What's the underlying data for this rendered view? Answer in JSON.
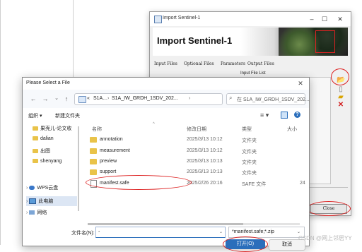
{
  "import_window": {
    "title": "Import Sentinel-1",
    "heading": "Import Sentinel-1",
    "min_icon": "minimize-icon",
    "max_icon": "maximize-icon",
    "close_icon": "close-icon",
    "tabs": [
      {
        "label": "Input Files"
      },
      {
        "label": "Optional Files"
      },
      {
        "label": "Parameters"
      },
      {
        "label": "Output Files"
      }
    ],
    "list_label": "Input File List",
    "close_label": "Close",
    "side_icons": [
      "add-file-icon",
      "page-icon",
      "folder-icon",
      "remove-icon"
    ]
  },
  "file_dialog": {
    "title": "Please Select a File",
    "nav": {
      "back": "←",
      "forward": "→",
      "recent": "⌄",
      "up": "↑",
      "refresh": "↻"
    },
    "address": {
      "ellipsis": "«",
      "segments": [
        "S1A...",
        "S1A_IW_GRDH_1SDV_202..."
      ],
      "sep": "›"
    },
    "search_placeholder": "在 S1A_IW_GRDH_1SDV_202...",
    "toolbar": {
      "organize": "组织 ▾",
      "new_folder": "新建文件夹",
      "view_icon": "≡ ▾"
    },
    "nav_items": [
      "果壳儿-论文收",
      "dalian",
      "出图",
      "shenyang",
      "WPS云盘",
      "此电脑",
      "网络"
    ],
    "columns": {
      "name": "名称",
      "date": "修改日期",
      "type": "类型",
      "size": "大小"
    },
    "files": [
      {
        "name": "annotation",
        "date": "2025/3/13 10:12",
        "type": "文件夹",
        "size": ""
      },
      {
        "name": "measurement",
        "date": "2025/3/13 10:12",
        "type": "文件夹",
        "size": ""
      },
      {
        "name": "preview",
        "date": "2025/3/13 10:13",
        "type": "文件夹",
        "size": ""
      },
      {
        "name": "support",
        "date": "2025/3/13 10:13",
        "type": "文件夹",
        "size": ""
      },
      {
        "name": "manifest.safe",
        "date": "2025/2/26 20:16",
        "type": "SAFE 文件",
        "size": "24"
      }
    ],
    "filename_label": "文件名(N):",
    "filename_value": "-",
    "filetype_value": "*manifest.safe;*.zip",
    "open_label": "打开(O)",
    "cancel_label": "取消",
    "help_label": "?",
    "close_icon": "close-icon"
  },
  "watermark": "CSDN @网上邻居YY",
  "colors": {
    "accent": "#2a6ebb",
    "annotation": "#dd2222",
    "folder": "#e9c349"
  }
}
